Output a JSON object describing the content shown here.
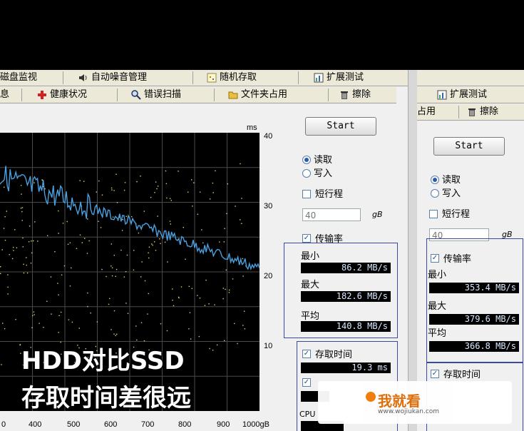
{
  "left": {
    "tabs_row1": [
      "磁盘监视",
      "自动噪音管理",
      "随机存取",
      "扩展测试"
    ],
    "tabs_row2": [
      "息",
      "健康状况",
      "错误扫描",
      "文件夹占用",
      "擦除"
    ],
    "start_label": "Start",
    "read_label": "读取",
    "write_label": "写入",
    "short_stroke_label": "短行程",
    "short_stroke_value": "40",
    "short_stroke_unit": "gB",
    "transfer_rate_label": "传输率",
    "min_label": "最小",
    "min_value": "86.2 MB/s",
    "max_label": "最大",
    "max_value": "182.6 MB/s",
    "avg_label": "平均",
    "avg_value": "140.8 MB/s",
    "access_time_label": "存取时间",
    "access_time_value": "19.3 ms",
    "cpu_label": "CPU"
  },
  "right": {
    "tabs_row2": [
      "扩展测试"
    ],
    "tabs_row3": [
      "占用",
      "擦除"
    ],
    "start_label": "Start",
    "read_label": "读取",
    "write_label": "写入",
    "short_stroke_label": "短行程",
    "short_stroke_value": "40",
    "short_stroke_unit": "gB",
    "transfer_rate_label": "传输率",
    "min_label": "最小",
    "min_value": "353.4 MB/s",
    "max_label": "最大",
    "max_value": "379.6 MB/s",
    "avg_label": "平均",
    "avg_value": "366.8 MB/s",
    "access_time_label": "存取时间"
  },
  "overlay": {
    "line1": "HDD对比SSD",
    "line2": "存取时间差很远"
  },
  "watermark": {
    "brand": "我就看",
    "url": "www.wojiukan.com"
  },
  "chart_data": {
    "type": "line",
    "y_unit": "ms",
    "y_ticks": [
      "40",
      "30",
      "20",
      "10"
    ],
    "x_ticks": [
      "0",
      "400",
      "500",
      "600",
      "700",
      "800",
      "900",
      "1000gB"
    ],
    "colors": {
      "line": "#4aa0e0",
      "dots": "#e0d070",
      "grid": "#4a4a4a",
      "bg": "#000000"
    }
  }
}
